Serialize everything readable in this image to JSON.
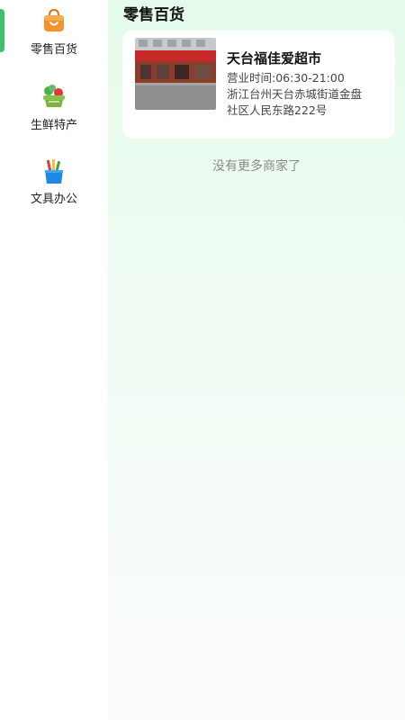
{
  "sidebar": {
    "categories": [
      {
        "label": "零售百货",
        "icon": "shopping-bag-icon",
        "active": true
      },
      {
        "label": "生鲜特产",
        "icon": "vegetable-basket-icon",
        "active": false
      },
      {
        "label": "文具办公",
        "icon": "stationery-cup-icon",
        "active": false
      }
    ]
  },
  "main": {
    "section_title": "零售百货",
    "stores": [
      {
        "name": "天台福佳爱超市",
        "hours": "营业时间:06:30-21:00",
        "address": "浙江台州天台赤城街道金盘社区人民东路222号",
        "photo_sign": "福佳爱生活超市"
      }
    ],
    "end_text": "没有更多商家了"
  },
  "colors": {
    "accent": "#3cc16a",
    "main_bg_top": "#e4fbeb"
  }
}
